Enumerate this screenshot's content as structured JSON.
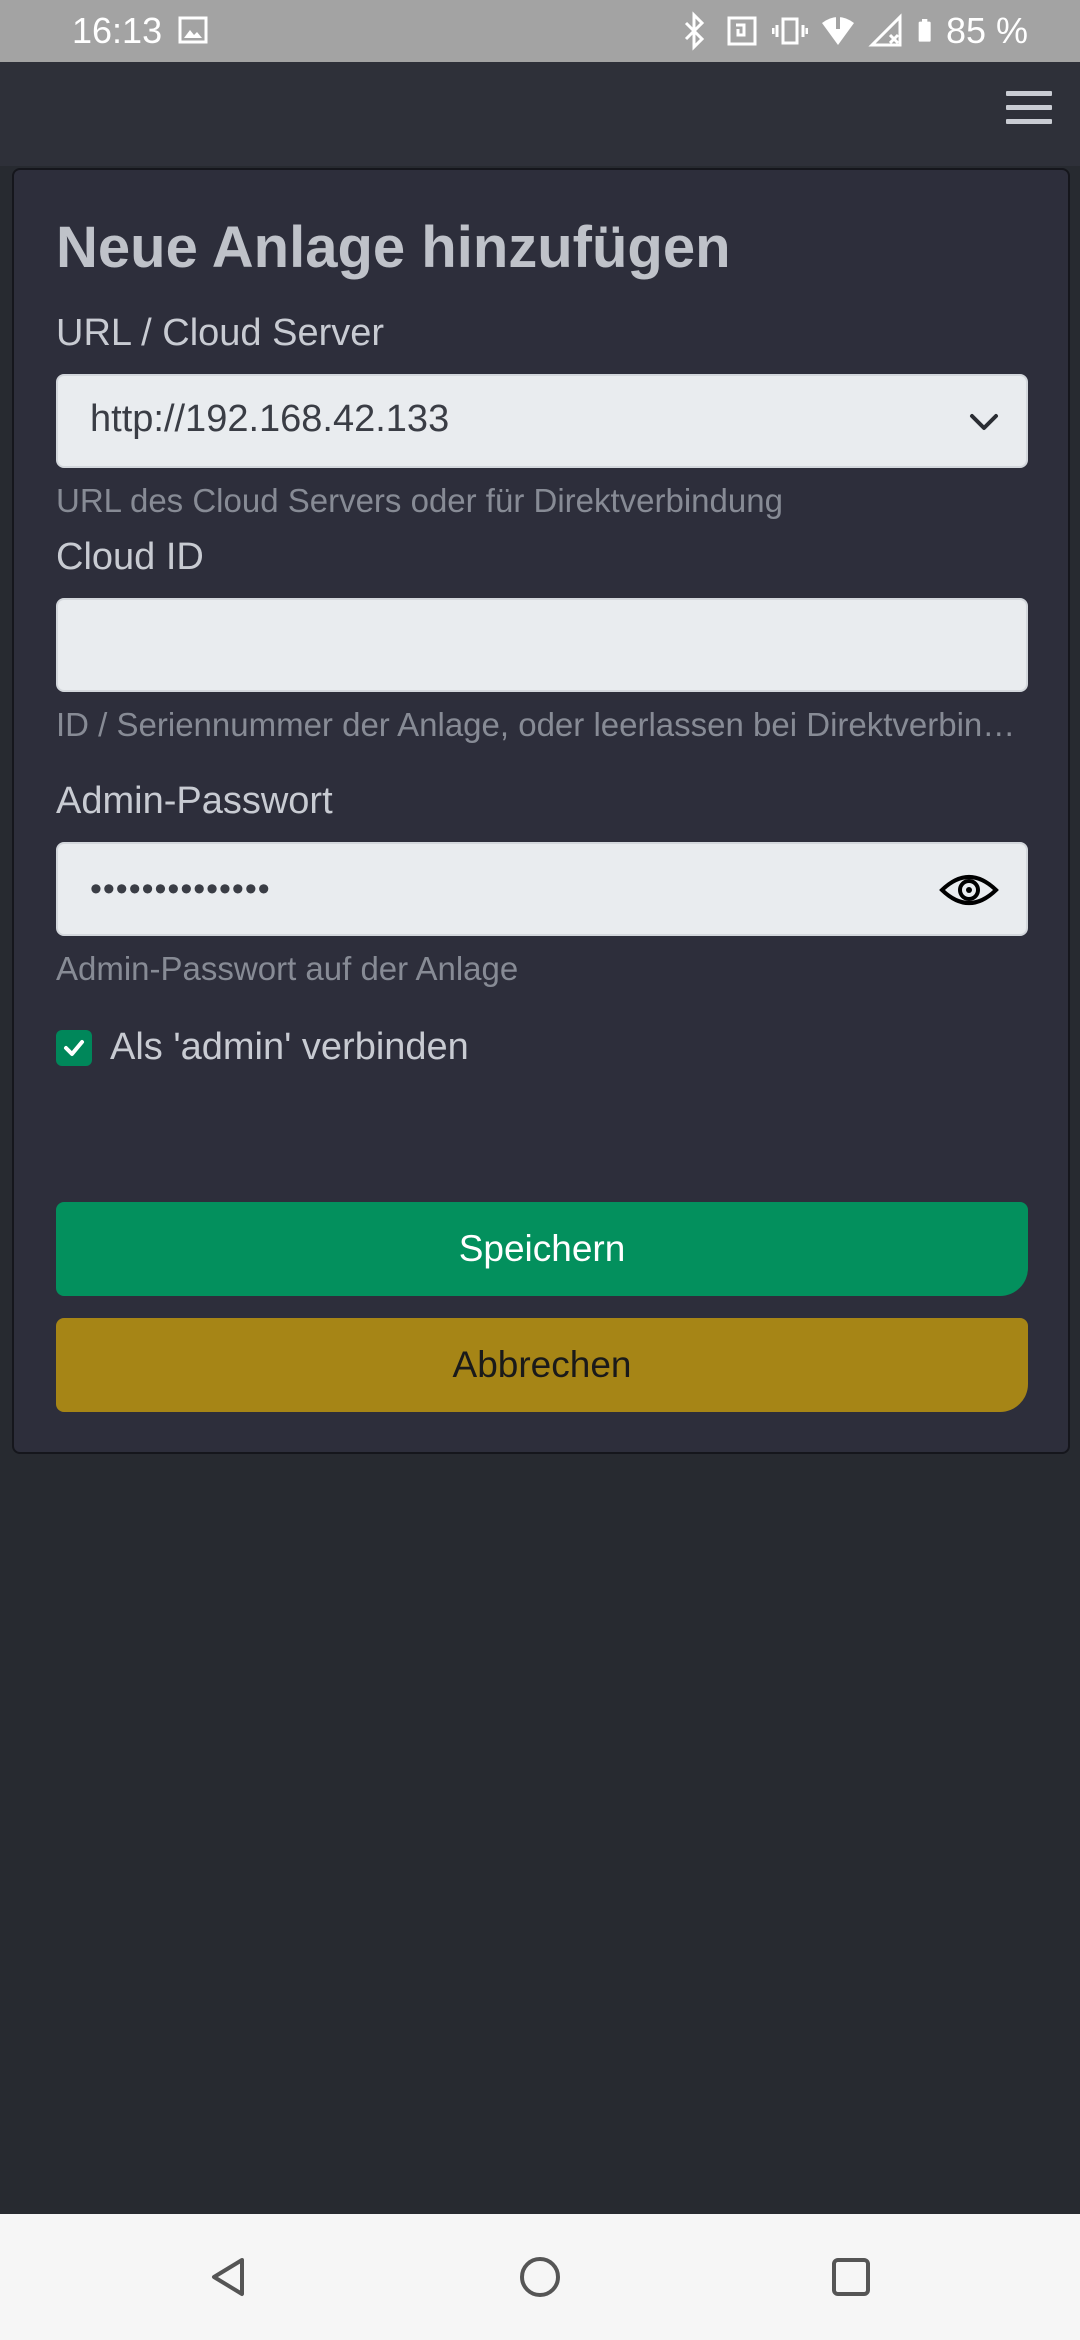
{
  "status_bar": {
    "time": "16:13",
    "battery": "85 %",
    "icons": [
      "image-icon",
      "bluetooth-icon",
      "nfc-icon",
      "vibrate-icon",
      "wifi-icon",
      "no-signal-icon",
      "battery-icon"
    ]
  },
  "app_bar": {
    "menu_icon": "hamburger-menu-icon"
  },
  "form": {
    "title": "Neue Anlage hinzufügen",
    "url": {
      "label": "URL / Cloud Server",
      "value": "http://192.168.42.133",
      "hint": "URL des Cloud Servers oder für Direktverbindung"
    },
    "cloud_id": {
      "label": "Cloud ID",
      "value": "",
      "hint": "ID / Seriennummer der Anlage, oder leerlassen bei Direktverbindung"
    },
    "password": {
      "label": "Admin-Passwort",
      "value": "••••••••••••••",
      "hint": "Admin-Passwort auf der Anlage"
    },
    "connect_as_admin": {
      "label": "Als 'admin' verbinden",
      "checked": true
    },
    "save_label": "Speichern",
    "cancel_label": "Abbrechen"
  },
  "colors": {
    "background": "#272a30",
    "card": "#2d2e3b",
    "save": "#03905d",
    "cancel": "#a68516",
    "checkbox": "#00875a"
  }
}
